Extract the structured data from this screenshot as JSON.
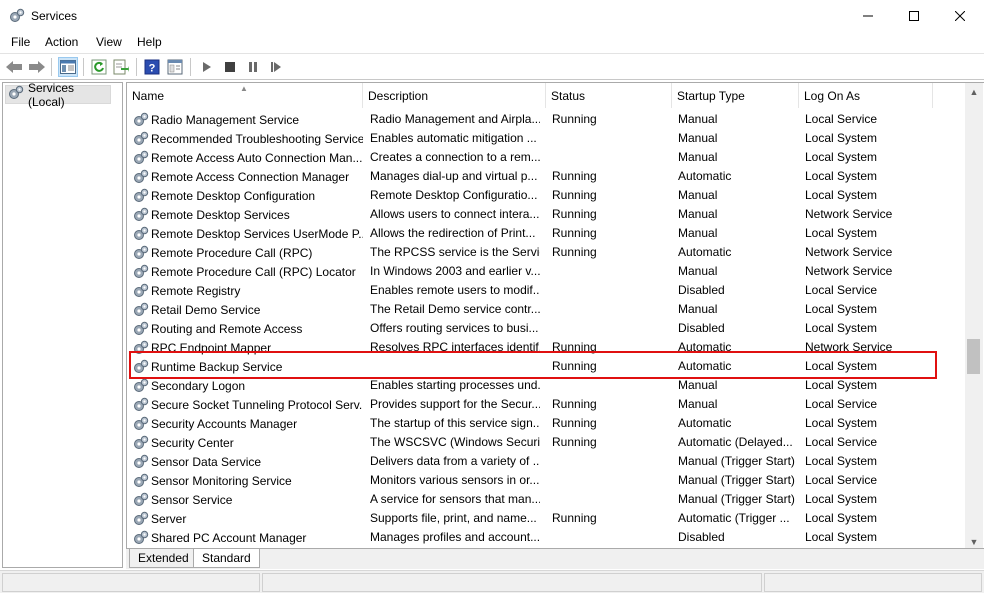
{
  "window": {
    "title": "Services",
    "icon": "services-gear-icon"
  },
  "menu": [
    "File",
    "Action",
    "View",
    "Help"
  ],
  "toolbar": {
    "buttons": [
      "back-icon",
      "forward-icon",
      "show-hide-console-tree-icon",
      "refresh-icon",
      "export-list-icon",
      "help-icon",
      "properties-icon",
      "start-service-icon",
      "stop-service-icon",
      "pause-service-icon",
      "restart-service-icon"
    ]
  },
  "tree": {
    "selected": "Services (Local)"
  },
  "columns": [
    "Name",
    "Description",
    "Status",
    "Startup Type",
    "Log On As"
  ],
  "rows": [
    {
      "name": "Radio Management Service",
      "desc": "Radio Management and Airpla...",
      "status": "Running",
      "startup": "Manual",
      "logon": "Local Service"
    },
    {
      "name": "Recommended Troubleshooting Service",
      "desc": "Enables automatic mitigation ...",
      "status": "",
      "startup": "Manual",
      "logon": "Local System"
    },
    {
      "name": "Remote Access Auto Connection Man...",
      "desc": "Creates a connection to a rem...",
      "status": "",
      "startup": "Manual",
      "logon": "Local System"
    },
    {
      "name": "Remote Access Connection Manager",
      "desc": "Manages dial-up and virtual p...",
      "status": "Running",
      "startup": "Automatic",
      "logon": "Local System"
    },
    {
      "name": "Remote Desktop Configuration",
      "desc": "Remote Desktop Configuratio...",
      "status": "Running",
      "startup": "Manual",
      "logon": "Local System"
    },
    {
      "name": "Remote Desktop Services",
      "desc": "Allows users to connect intera...",
      "status": "Running",
      "startup": "Manual",
      "logon": "Network Service"
    },
    {
      "name": "Remote Desktop Services UserMode P...",
      "desc": "Allows the redirection of Print...",
      "status": "Running",
      "startup": "Manual",
      "logon": "Local System"
    },
    {
      "name": "Remote Procedure Call (RPC)",
      "desc": "The RPCSS service is the Servic...",
      "status": "Running",
      "startup": "Automatic",
      "logon": "Network Service"
    },
    {
      "name": "Remote Procedure Call (RPC) Locator",
      "desc": "In Windows 2003 and earlier v...",
      "status": "",
      "startup": "Manual",
      "logon": "Network Service"
    },
    {
      "name": "Remote Registry",
      "desc": "Enables remote users to modif...",
      "status": "",
      "startup": "Disabled",
      "logon": "Local Service"
    },
    {
      "name": "Retail Demo Service",
      "desc": "The Retail Demo service contr...",
      "status": "",
      "startup": "Manual",
      "logon": "Local System"
    },
    {
      "name": "Routing and Remote Access",
      "desc": "Offers routing services to busi...",
      "status": "",
      "startup": "Disabled",
      "logon": "Local System"
    },
    {
      "name": "RPC Endpoint Mapper",
      "desc": "Resolves RPC interfaces identif...",
      "status": "Running",
      "startup": "Automatic",
      "logon": "Network Service"
    },
    {
      "name": "Runtime Backup Service",
      "desc": "",
      "status": "Running",
      "startup": "Automatic",
      "logon": "Local System"
    },
    {
      "name": "Secondary Logon",
      "desc": "Enables starting processes und...",
      "status": "",
      "startup": "Manual",
      "logon": "Local System"
    },
    {
      "name": "Secure Socket Tunneling Protocol Serv...",
      "desc": "Provides support for the Secur...",
      "status": "Running",
      "startup": "Manual",
      "logon": "Local Service"
    },
    {
      "name": "Security Accounts Manager",
      "desc": "The startup of this service sign...",
      "status": "Running",
      "startup": "Automatic",
      "logon": "Local System"
    },
    {
      "name": "Security Center",
      "desc": "The WSCSVC (Windows Securi...",
      "status": "Running",
      "startup": "Automatic (Delayed...",
      "logon": "Local Service"
    },
    {
      "name": "Sensor Data Service",
      "desc": "Delivers data from a variety of ...",
      "status": "",
      "startup": "Manual (Trigger Start)",
      "logon": "Local System"
    },
    {
      "name": "Sensor Monitoring Service",
      "desc": "Monitors various sensors in or...",
      "status": "",
      "startup": "Manual (Trigger Start)",
      "logon": "Local Service"
    },
    {
      "name": "Sensor Service",
      "desc": "A service for sensors that man...",
      "status": "",
      "startup": "Manual (Trigger Start)",
      "logon": "Local System"
    },
    {
      "name": "Server",
      "desc": "Supports file, print, and name...",
      "status": "Running",
      "startup": "Automatic (Trigger ...",
      "logon": "Local System"
    },
    {
      "name": "Shared PC Account Manager",
      "desc": "Manages profiles and account...",
      "status": "",
      "startup": "Disabled",
      "logon": "Local System"
    }
  ],
  "highlight_color": "#e01010",
  "tabs": [
    "Extended",
    "Standard"
  ]
}
